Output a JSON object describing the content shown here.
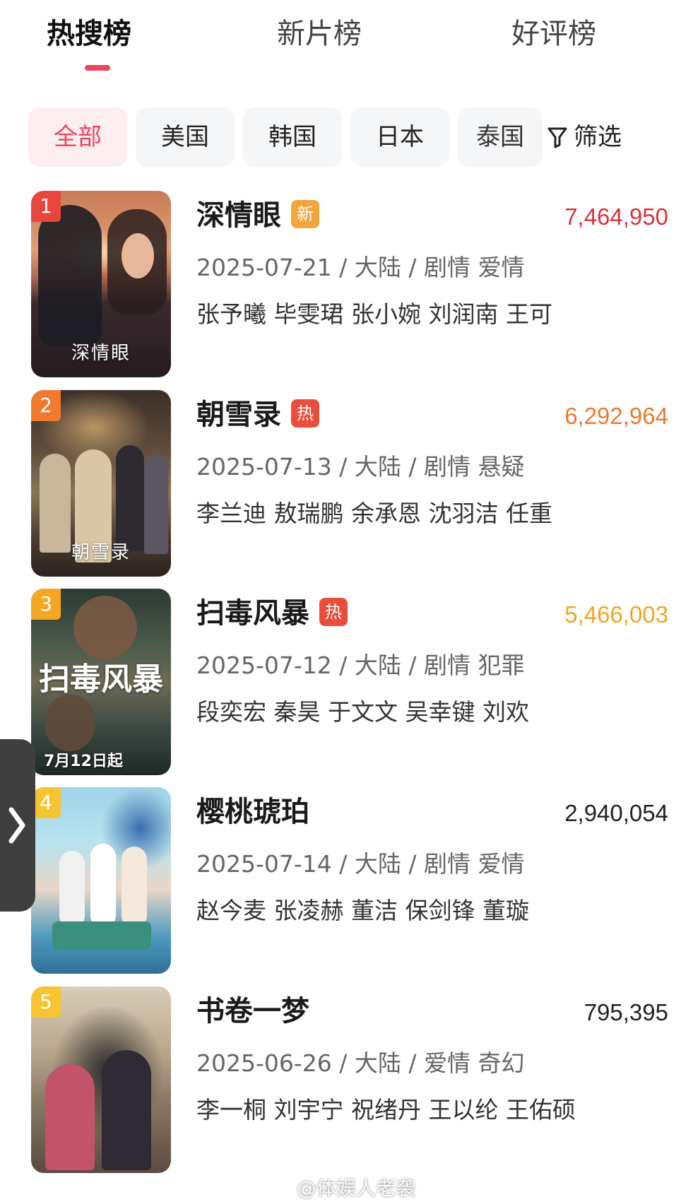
{
  "tabs": [
    {
      "label": "热搜榜",
      "active": true
    },
    {
      "label": "新片榜",
      "active": false
    },
    {
      "label": "好评榜",
      "active": false
    }
  ],
  "filters": {
    "chips": [
      "全部",
      "美国",
      "韩国",
      "日本",
      "泰国"
    ],
    "active_index": 0,
    "filter_label": "筛选",
    "filter_icon": "funnel-icon"
  },
  "items": [
    {
      "rank": "1",
      "title": "深情眼",
      "badge": "新",
      "heat": "7,464,950",
      "meta": "2025-07-21 / 大陆 / 剧情 爱情",
      "cast": "张予曦 毕雯珺 张小婉 刘润南 王可",
      "poster_text": "深情眼"
    },
    {
      "rank": "2",
      "title": "朝雪录",
      "badge": "热",
      "heat": "6,292,964",
      "meta": "2025-07-13 / 大陆 / 剧情 悬疑",
      "cast": "李兰迪 敖瑞鹏 余承恩 沈羽洁 任重",
      "poster_text": "朝雪录"
    },
    {
      "rank": "3",
      "title": "扫毒风暴",
      "badge": "热",
      "heat": "5,466,003",
      "meta": "2025-07-12 / 大陆 / 剧情 犯罪",
      "cast": "段奕宏 秦昊 于文文 吴幸键 刘欢",
      "poster_text": "扫毒风暴",
      "poster_date": "7月12日起"
    },
    {
      "rank": "4",
      "title": "樱桃琥珀",
      "badge": "",
      "heat": "2,940,054",
      "meta": "2025-07-14 / 大陆 / 剧情 爱情",
      "cast": "赵今麦 张凌赫 董洁 保剑锋 董璇"
    },
    {
      "rank": "5",
      "title": "书卷一梦",
      "badge": "",
      "heat": "795,395",
      "meta": "2025-06-26 / 大陆 / 爱情 奇幻",
      "cast": "李一桐 刘宇宁 祝绪丹 王以纶 王佑硕"
    }
  ],
  "watermark": "@体娱人老袭",
  "colors": {
    "accent": "#e8455f",
    "rank_1": "#e8453c",
    "rank_2": "#f07a2e",
    "rank_3": "#f5a623",
    "rank_4": "#f7c531",
    "rank_5": "#f7c531",
    "heat_1": "#d9343a",
    "heat_2": "#ea7a30",
    "heat_3": "#efa626",
    "heat_default": "#222222",
    "badge_new": "#f2a53b",
    "badge_hot": "#eb4d3d"
  }
}
